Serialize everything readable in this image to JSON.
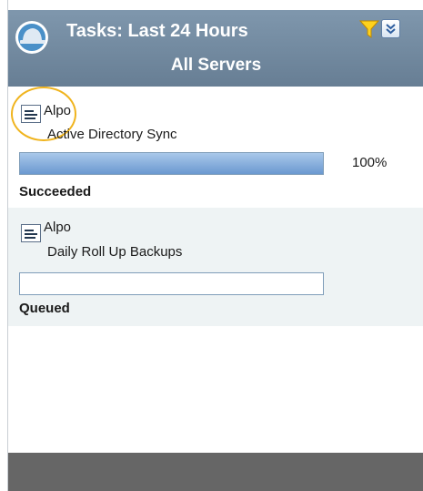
{
  "header": {
    "title": "Tasks: Last 24 Hours",
    "subtitle": "All Servers",
    "icons": {
      "app": "hard-hat-icon",
      "filter": "filter-icon",
      "collapse": "chevron-double-down-icon"
    }
  },
  "tasks": [
    {
      "server": "Alpo",
      "name": "Active Directory Sync",
      "progress_fraction": 1.0,
      "progress_label": "100%",
      "status": "Succeeded",
      "icon": "task-list-icon"
    },
    {
      "server": "Alpo",
      "name": "Daily Roll Up Backups",
      "progress_fraction": 0.0,
      "progress_label": "",
      "status": "Queued",
      "icon": "task-list-icon"
    }
  ],
  "colors": {
    "header": "#7089a0",
    "progress_fill": "#6b99d0",
    "alt_row": "#eef3f4",
    "footer": "#666666",
    "highlight": "#f0b41e"
  }
}
